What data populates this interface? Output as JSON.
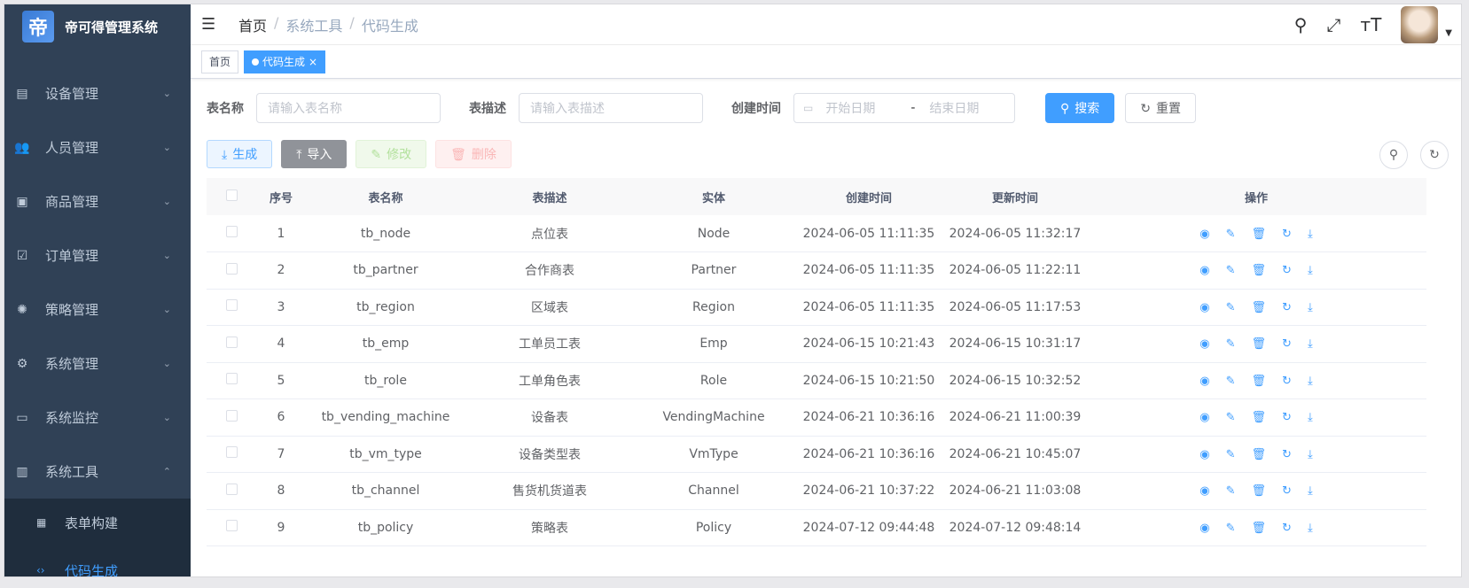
{
  "sidebar": {
    "app_title": "帝可得管理系统",
    "logo_glyph": "帝",
    "menu": [
      {
        "label": "设备管理",
        "icon": "device-icon",
        "glyph": "▤"
      },
      {
        "label": "人员管理",
        "icon": "people-icon",
        "glyph": "👥"
      },
      {
        "label": "商品管理",
        "icon": "goods-icon",
        "glyph": "▣"
      },
      {
        "label": "订单管理",
        "icon": "order-icon",
        "glyph": "☑"
      },
      {
        "label": "策略管理",
        "icon": "strategy-icon",
        "glyph": "✺"
      },
      {
        "label": "系统管理",
        "icon": "gear-icon",
        "glyph": "⚙"
      },
      {
        "label": "系统监控",
        "icon": "monitor-icon",
        "glyph": "▭"
      },
      {
        "label": "系统工具",
        "icon": "toolbox-icon",
        "glyph": "▥"
      }
    ],
    "submenu": [
      {
        "label": "表单构建",
        "icon": "form-icon",
        "glyph": "▦"
      },
      {
        "label": "代码生成",
        "icon": "code-icon",
        "glyph": "‹›"
      }
    ]
  },
  "navbar": {
    "breadcrumb": [
      "首页",
      "系统工具",
      "代码生成"
    ]
  },
  "tags": {
    "home": "首页",
    "active": "代码生成"
  },
  "query": {
    "table_name_label": "表名称",
    "table_name_placeholder": "请输入表名称",
    "table_desc_label": "表描述",
    "table_desc_placeholder": "请输入表描述",
    "created_label": "创建时间",
    "start_date": "开始日期",
    "date_sep": "-",
    "end_date": "结束日期",
    "search": "搜索",
    "reset": "重置"
  },
  "toolbar": {
    "generate": "生成",
    "import": "导入",
    "edit": "修改",
    "delete": "删除"
  },
  "table": {
    "headers": [
      "序号",
      "表名称",
      "表描述",
      "实体",
      "创建时间",
      "更新时间",
      "操作"
    ],
    "rows": [
      {
        "no": "1",
        "name": "tb_node",
        "desc": "点位表",
        "entity": "Node",
        "created": "2024-06-05 11:11:35",
        "updated": "2024-06-05 11:32:17"
      },
      {
        "no": "2",
        "name": "tb_partner",
        "desc": "合作商表",
        "entity": "Partner",
        "created": "2024-06-05 11:11:35",
        "updated": "2024-06-05 11:22:11"
      },
      {
        "no": "3",
        "name": "tb_region",
        "desc": "区域表",
        "entity": "Region",
        "created": "2024-06-05 11:11:35",
        "updated": "2024-06-05 11:17:53"
      },
      {
        "no": "4",
        "name": "tb_emp",
        "desc": "工单员工表",
        "entity": "Emp",
        "created": "2024-06-15 10:21:43",
        "updated": "2024-06-15 10:31:17"
      },
      {
        "no": "5",
        "name": "tb_role",
        "desc": "工单角色表",
        "entity": "Role",
        "created": "2024-06-15 10:21:50",
        "updated": "2024-06-15 10:32:52"
      },
      {
        "no": "6",
        "name": "tb_vending_machine",
        "desc": "设备表",
        "entity": "VendingMachine",
        "created": "2024-06-21 10:36:16",
        "updated": "2024-06-21 11:00:39"
      },
      {
        "no": "7",
        "name": "tb_vm_type",
        "desc": "设备类型表",
        "entity": "VmType",
        "created": "2024-06-21 10:36:16",
        "updated": "2024-06-21 10:45:07"
      },
      {
        "no": "8",
        "name": "tb_channel",
        "desc": "售货机货道表",
        "entity": "Channel",
        "created": "2024-06-21 10:37:22",
        "updated": "2024-06-21 11:03:08"
      },
      {
        "no": "9",
        "name": "tb_policy",
        "desc": "策略表",
        "entity": "Policy",
        "created": "2024-07-12 09:44:48",
        "updated": "2024-07-12 09:48:14"
      }
    ]
  },
  "colors": {
    "sidebar": "#304156",
    "primary": "#409eff"
  }
}
